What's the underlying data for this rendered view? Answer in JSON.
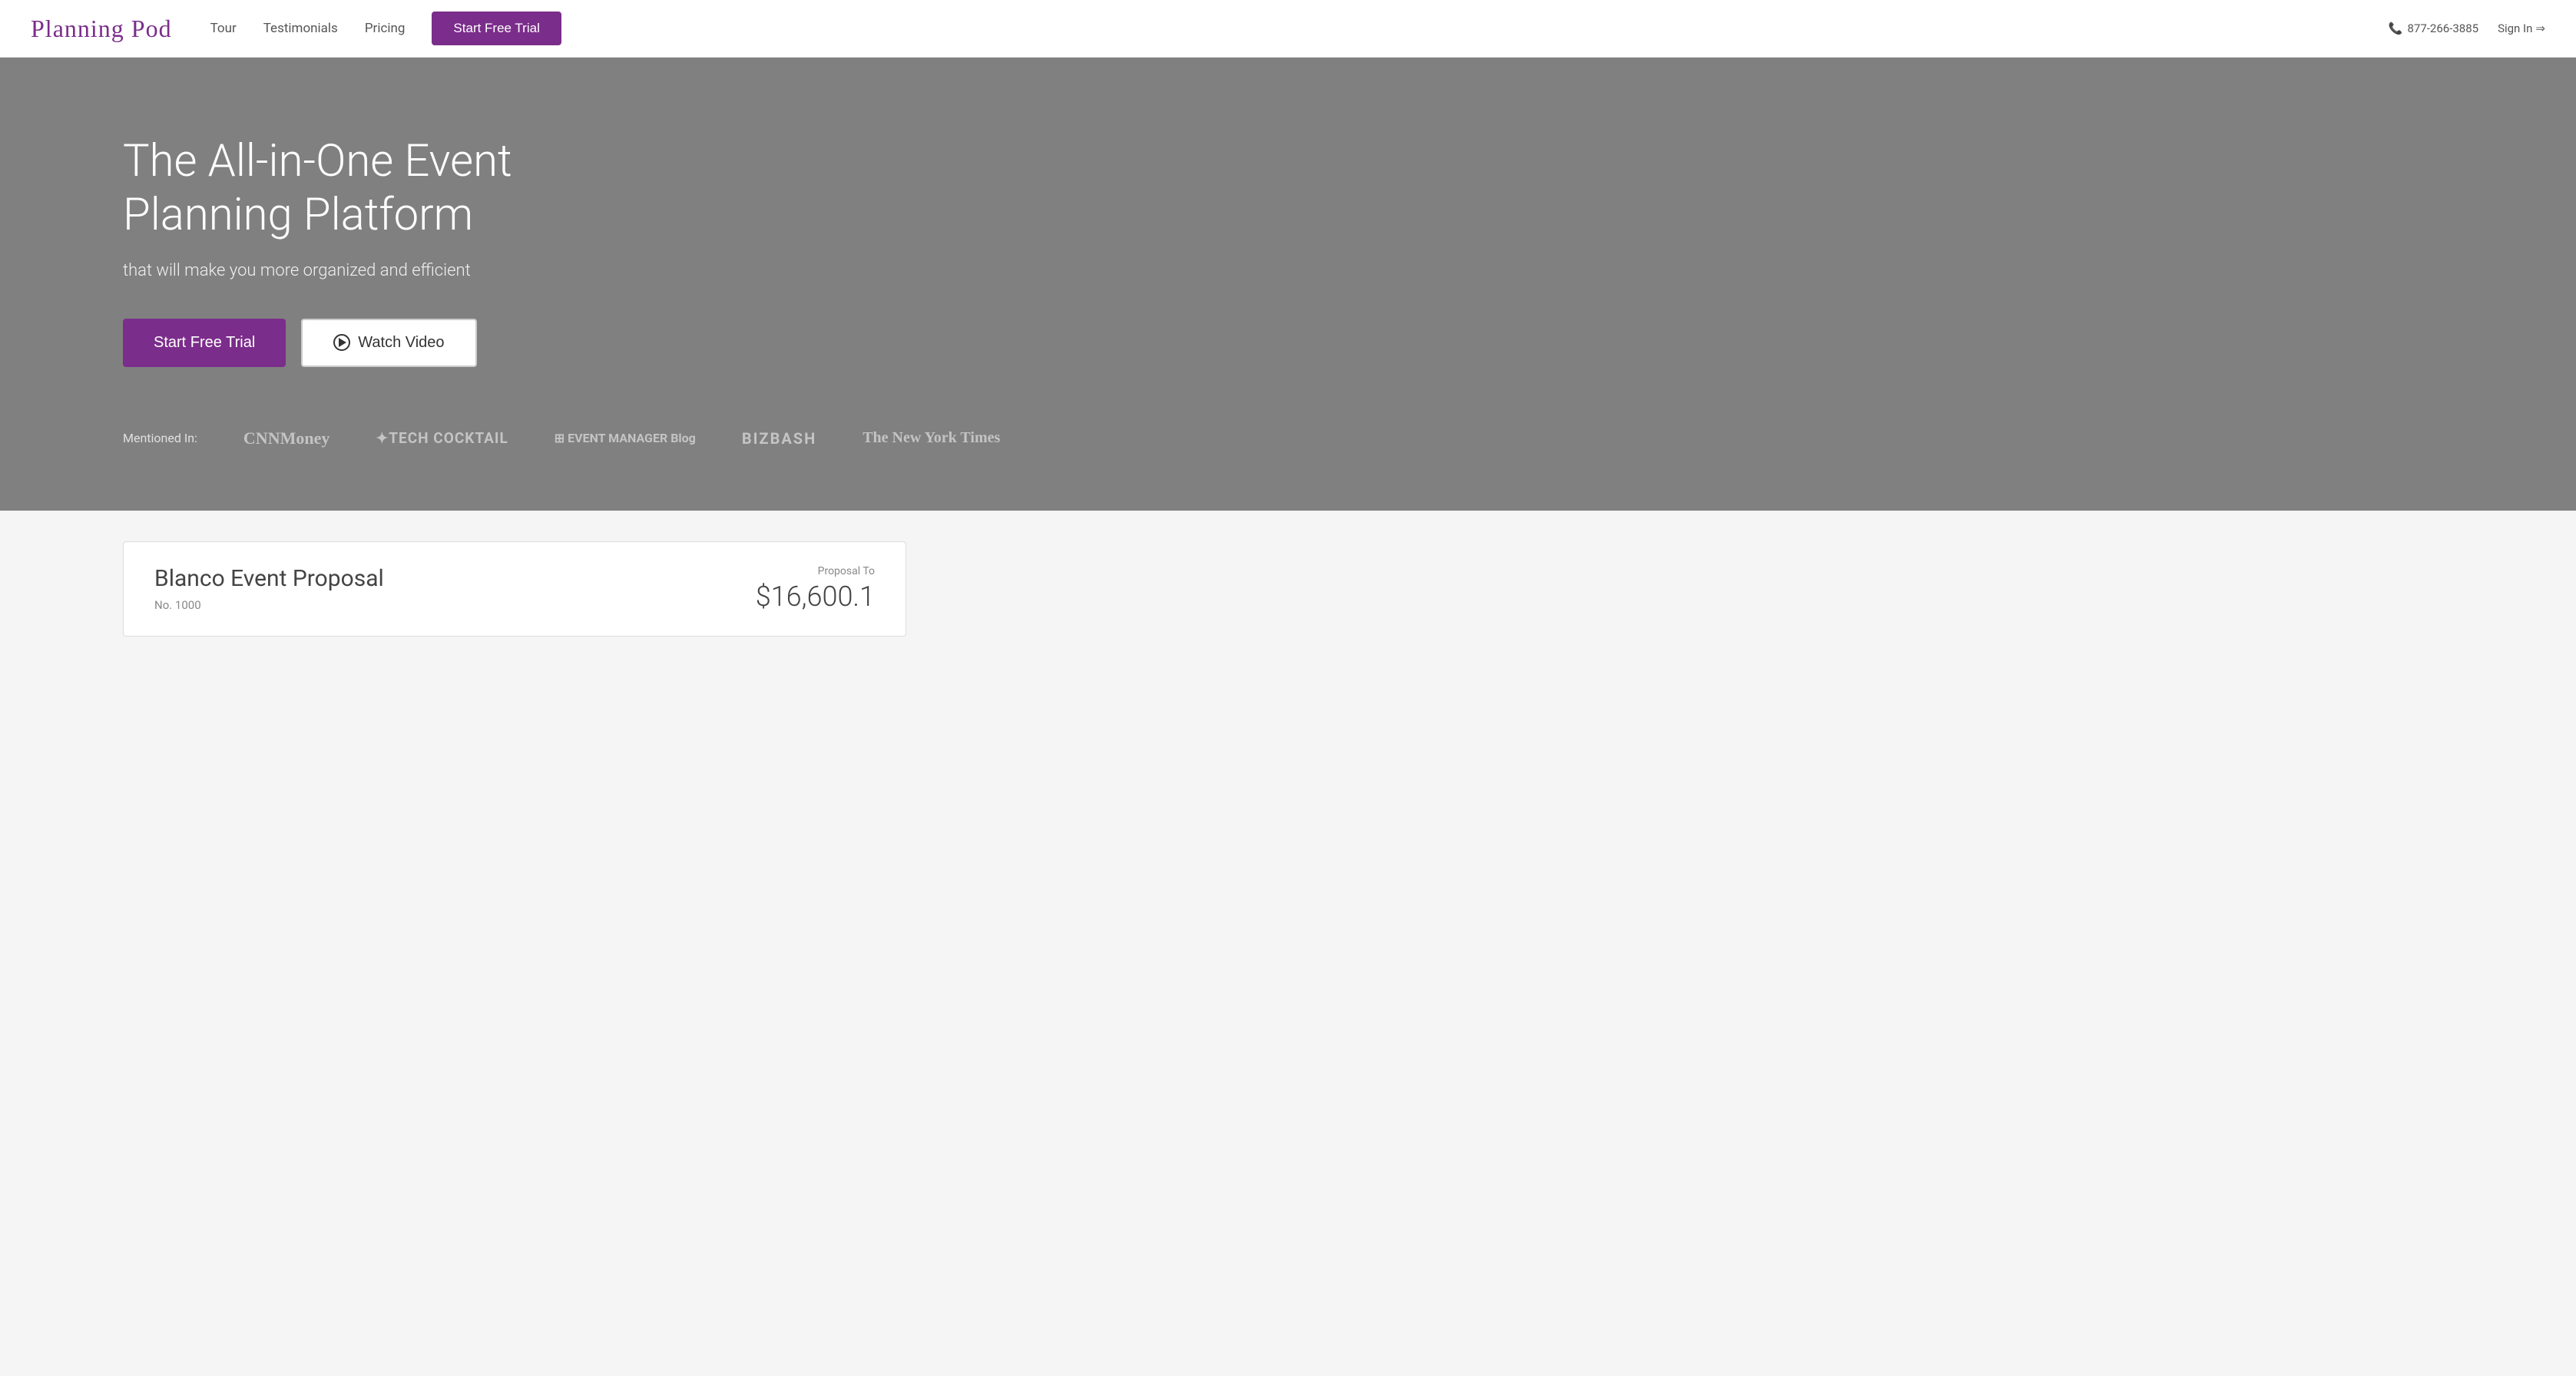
{
  "navbar": {
    "logo": "Planning Pod",
    "links": [
      {
        "label": "Tour",
        "href": "#"
      },
      {
        "label": "Testimonials",
        "href": "#"
      },
      {
        "label": "Pricing",
        "href": "#"
      }
    ],
    "cta_label": "Start Free Trial",
    "phone": "877-266-3885",
    "signin_label": "Sign In",
    "signin_arrow": "→"
  },
  "hero": {
    "title": "The All-in-One Event Planning Platform",
    "subtitle": "that will make you more organized and efficient",
    "btn_trial": "Start Free Trial",
    "btn_video": "Watch Video",
    "mentioned_label": "Mentioned In:",
    "press_logos": [
      {
        "name": "CNNMoney",
        "display": "CNNMoney"
      },
      {
        "name": "TechCocktail",
        "display": "✦TECH COCKTAIL"
      },
      {
        "name": "EventManagerBlog",
        "display": "⊞ EVENT MANAGER Blog"
      },
      {
        "name": "BizBash",
        "display": "BIZBASH"
      },
      {
        "name": "NewYorkTimes",
        "display": "The New York Times"
      }
    ]
  },
  "proposal": {
    "title": "Blanco Event Proposal",
    "number_label": "No. 1000",
    "amount_label": "Proposal To",
    "amount": "$16,600.1"
  }
}
